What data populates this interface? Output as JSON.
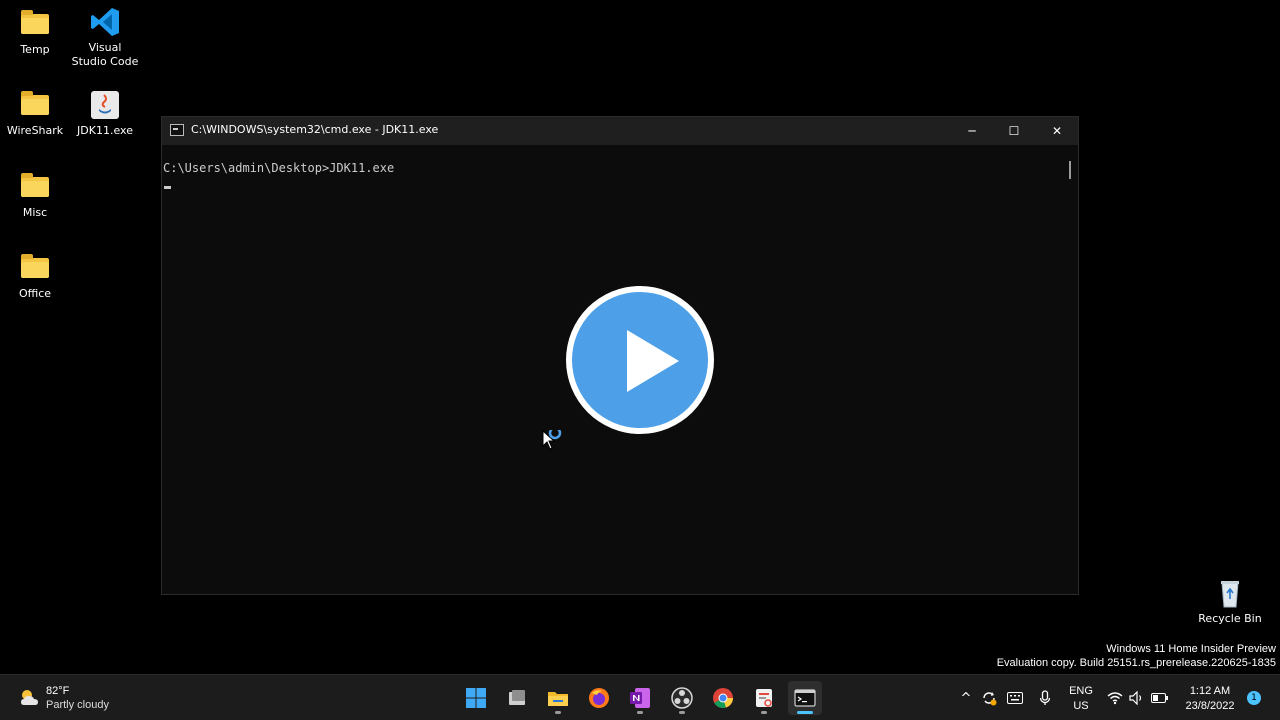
{
  "desktop": {
    "icons": [
      {
        "label": "Temp",
        "icon": "folder-icon"
      },
      {
        "label": "Visual Studio Code",
        "icon": "vscode-icon"
      },
      {
        "label": "WireShark",
        "icon": "folder-icon"
      },
      {
        "label": "JDK11.exe",
        "icon": "java-installer-icon"
      },
      {
        "label": "Misc",
        "icon": "folder-icon"
      },
      {
        "label": "Office",
        "icon": "folder-icon"
      }
    ],
    "recycle_bin": "Recycle Bin",
    "watermark": {
      "line1": "Windows 11 Home Insider Preview",
      "line2": "Evaluation copy. Build 25151.rs_prerelease.220625-1835"
    }
  },
  "cmd_window": {
    "title": "C:\\WINDOWS\\system32\\cmd.exe - JDK11.exe",
    "prompt_line": "C:\\Users\\admin\\Desktop>JDK11.exe",
    "min_label": "─",
    "max_label": "☐",
    "close_label": "✕"
  },
  "video_overlay": {
    "icon": "play-icon"
  },
  "taskbar": {
    "weather": {
      "temp": "82°F",
      "condition": "Partly cloudy"
    },
    "apps": [
      "start-icon",
      "task-view-icon",
      "file-explorer-icon",
      "firefox-icon",
      "onenote-icon",
      "obs-icon",
      "chrome-icon",
      "snipping-tool-icon",
      "terminal-icon"
    ],
    "language": {
      "line1": "ENG",
      "line2": "US"
    },
    "clock": {
      "time": "1:12 AM",
      "date": "23/8/2022"
    },
    "notification_count": "1"
  },
  "colors": {
    "accent": "#4cc2ff",
    "play": "#4da0e8",
    "folder": "#f4c542"
  }
}
